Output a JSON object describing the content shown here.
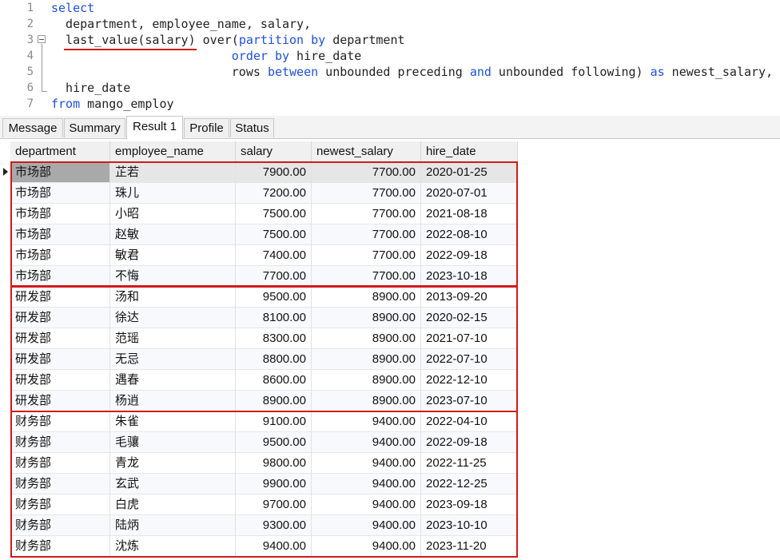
{
  "editor": {
    "line_numbers": [
      "1",
      "2",
      "3",
      "4",
      "5",
      "6",
      "7"
    ],
    "line1": {
      "kw": "select"
    },
    "line2": {
      "text": "  department, employee_name, salary,"
    },
    "line3": {
      "fn": "  last_value(salary) over(",
      "kw1": "partition",
      "sp1": " ",
      "kw2": "by",
      "rest": " department"
    },
    "line4": {
      "pad": "                         ",
      "kw1": "order",
      "sp1": " ",
      "kw2": "by",
      "rest": " hire_date"
    },
    "line5": {
      "pad": "                         rows ",
      "kw1": "between",
      "mid": " unbounded preceding ",
      "kw2": "and",
      "mid2": " unbounded following) ",
      "kw3": "as",
      "rest": " newest_salary,"
    },
    "line6": {
      "text": "  hire_date"
    },
    "line7": {
      "kw": "from",
      "rest": " mango_employ"
    }
  },
  "tabs": [
    "Message",
    "Summary",
    "Result 1",
    "Profile",
    "Status"
  ],
  "active_tab": "Result 1",
  "table": {
    "columns": [
      "department",
      "employee_name",
      "salary",
      "newest_salary",
      "hire_date"
    ],
    "rows": [
      [
        "市场部",
        "芷若",
        "7900.00",
        "7700.00",
        "2020-01-25"
      ],
      [
        "市场部",
        "珠儿",
        "7200.00",
        "7700.00",
        "2020-07-01"
      ],
      [
        "市场部",
        "小昭",
        "7500.00",
        "7700.00",
        "2021-08-18"
      ],
      [
        "市场部",
        "赵敏",
        "7500.00",
        "7700.00",
        "2022-08-10"
      ],
      [
        "市场部",
        "敏君",
        "7400.00",
        "7700.00",
        "2022-09-18"
      ],
      [
        "市场部",
        "不悔",
        "7700.00",
        "7700.00",
        "2023-10-18"
      ],
      [
        "研发部",
        "汤和",
        "9500.00",
        "8900.00",
        "2013-09-20"
      ],
      [
        "研发部",
        "徐达",
        "8100.00",
        "8900.00",
        "2020-02-15"
      ],
      [
        "研发部",
        "范瑶",
        "8300.00",
        "8900.00",
        "2021-07-10"
      ],
      [
        "研发部",
        "无忌",
        "8800.00",
        "8900.00",
        "2022-07-10"
      ],
      [
        "研发部",
        "遇春",
        "8600.00",
        "8900.00",
        "2022-12-10"
      ],
      [
        "研发部",
        "杨逍",
        "8900.00",
        "8900.00",
        "2023-07-10"
      ],
      [
        "财务部",
        "朱雀",
        "9100.00",
        "9400.00",
        "2022-04-10"
      ],
      [
        "财务部",
        "毛骧",
        "9500.00",
        "9400.00",
        "2022-09-18"
      ],
      [
        "财务部",
        "青龙",
        "9800.00",
        "9400.00",
        "2022-11-25"
      ],
      [
        "财务部",
        "玄武",
        "9900.00",
        "9400.00",
        "2022-12-25"
      ],
      [
        "财务部",
        "白虎",
        "9700.00",
        "9400.00",
        "2023-09-18"
      ],
      [
        "财务部",
        "陆炳",
        "9300.00",
        "9400.00",
        "2023-10-10"
      ],
      [
        "财务部",
        "沈炼",
        "9400.00",
        "9400.00",
        "2023-11-20"
      ]
    ]
  },
  "colors": {
    "keyword": "#1f4fd8",
    "highlight_box": "#d11a1a"
  }
}
